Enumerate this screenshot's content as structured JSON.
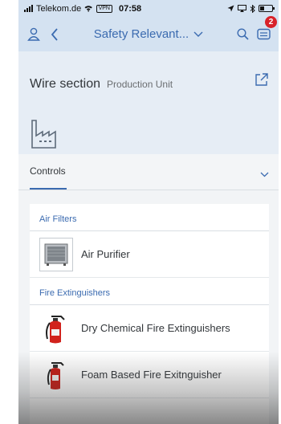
{
  "status_bar": {
    "carrier": "Telekom.de",
    "vpn": "VPN",
    "time": "07:58",
    "battery_level": 0.35
  },
  "shell_bar": {
    "title": "Safety Relevant...",
    "notification_count": "2",
    "accent_color": "#3b6bb0"
  },
  "header": {
    "title": "Wire section",
    "subtitle": "Production Unit"
  },
  "tabs": {
    "active": "Controls"
  },
  "list": {
    "groups": [
      {
        "title": "Air Filters",
        "items": [
          {
            "label": "Air Purifier",
            "icon": "air-purifier-icon"
          }
        ]
      },
      {
        "title": "Fire Extinguishers",
        "items": [
          {
            "label": "Dry Chemical Fire Extinguishers",
            "icon": "fire-extinguisher-icon"
          },
          {
            "label": "Foam Based Fire Exitnguisher",
            "icon": "fire-extinguisher-icon"
          }
        ]
      }
    ]
  }
}
